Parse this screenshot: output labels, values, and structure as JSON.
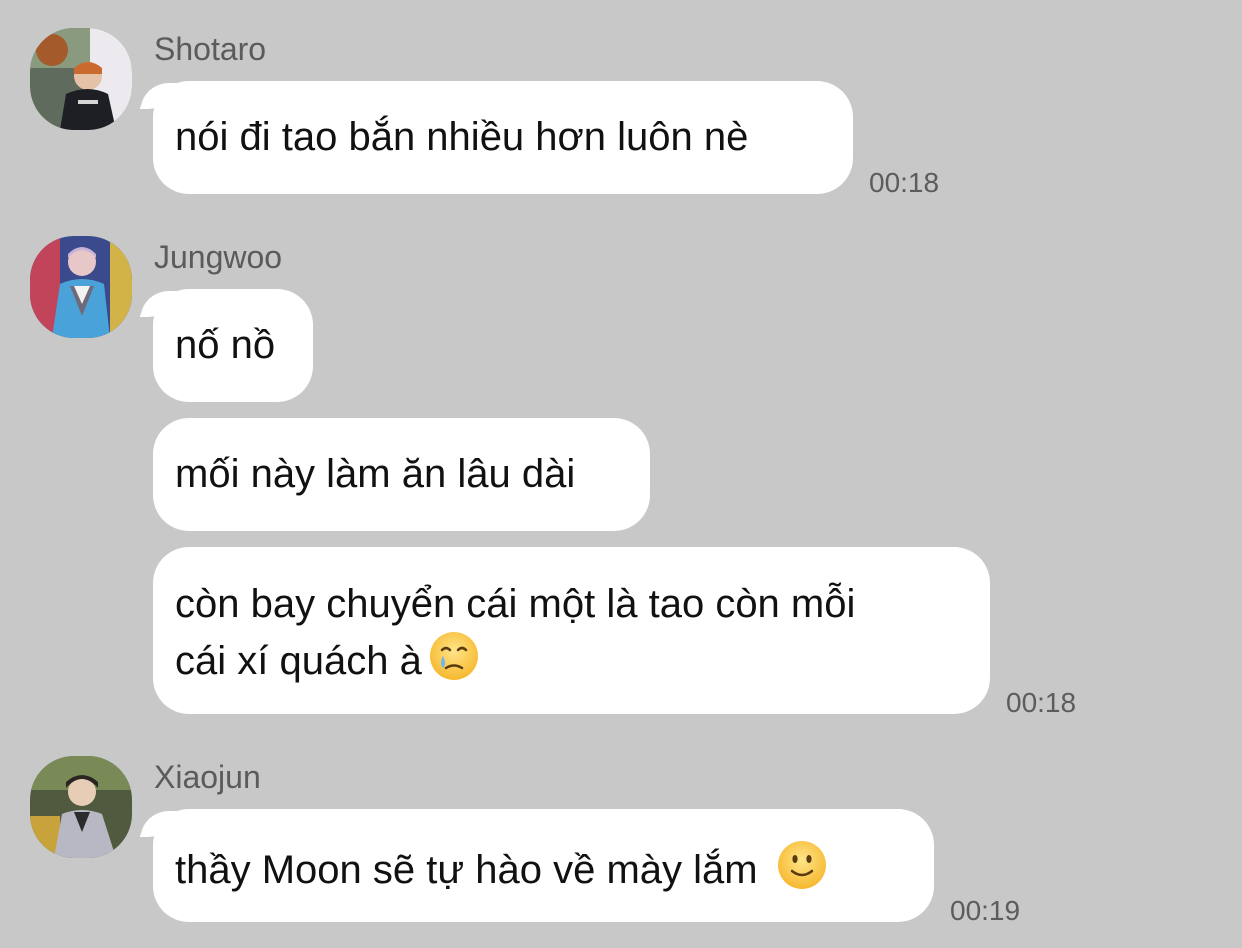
{
  "messages": [
    {
      "sender": "Shotaro",
      "avatar_icon": "avatar-shotaro",
      "bubbles": [
        "nói đi tao bắn nhiều hơn luôn nè"
      ],
      "time": "00:18"
    },
    {
      "sender": "Jungwoo",
      "avatar_icon": "avatar-jungwoo",
      "bubbles": [
        "nố nồ",
        "mối này làm ăn lâu dài",
        "còn bay chuyển cái một là tao còn mỗi",
        "cái xí quách à"
      ],
      "time": "00:18"
    },
    {
      "sender": "Xiaojun",
      "avatar_icon": "avatar-xiaojun",
      "bubbles": [
        "thầy Moon sẽ tự hào về mày lắm"
      ],
      "time": "00:19"
    }
  ],
  "emoji": {
    "crying_face": "face-holding-back-tears-icon",
    "smiling_face": "slightly-smiling-face-icon"
  },
  "colors": {
    "background": "#c8c8c8",
    "bubble": "#ffffff",
    "meta_text": "#5b5b5b"
  }
}
